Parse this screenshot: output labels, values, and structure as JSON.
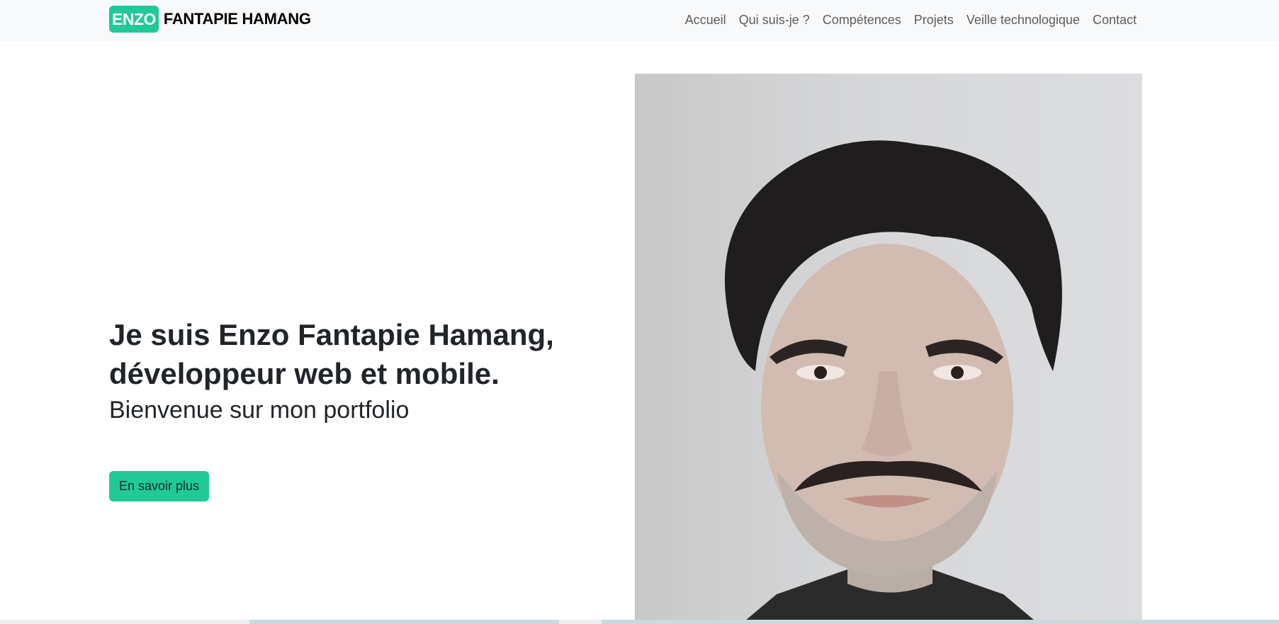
{
  "navbar": {
    "brand_badge": "ENZO",
    "brand_name": "FANTAPIE HAMANG",
    "links": [
      "Accueil",
      "Qui suis-je ?",
      "Compétences",
      "Projets",
      "Veille technologique",
      "Contact"
    ]
  },
  "hero": {
    "title_line1": "Je suis Enzo Fantapie Hamang,",
    "title_line2": "développeur web et mobile.",
    "subtitle": "Bienvenue sur mon portfolio",
    "cta_label": "En savoir plus"
  },
  "colors": {
    "accent": "#20c997",
    "navbar_bg": "#f8f9fa",
    "text": "#212529"
  },
  "portrait": {
    "icon": "profile-photo"
  }
}
